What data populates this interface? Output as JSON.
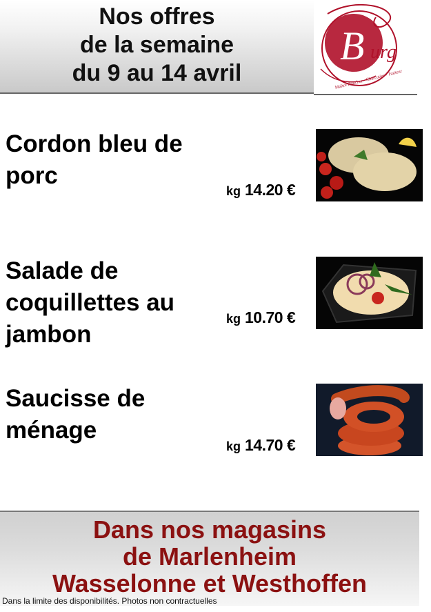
{
  "header": {
    "title_lines": [
      "Nos offres",
      "de la semaine",
      "du 9 au 14 avril"
    ]
  },
  "logo": {
    "letter": "B",
    "text": "urg",
    "tagline": "Maître Boucher - Charcutier - Traiteur",
    "color": "#b0112a"
  },
  "products": [
    {
      "name_lines": [
        "Cordon bleu de",
        "porc"
      ],
      "unit": "kg",
      "price": "14.20 €"
    },
    {
      "name_lines": [
        "Salade de",
        "coquillettes au",
        "jambon"
      ],
      "unit": "kg",
      "price": "10.70 €"
    },
    {
      "name_lines": [
        "Saucisse de",
        "ménage"
      ],
      "unit": "kg",
      "price": "14.70 €"
    }
  ],
  "footer": {
    "lines": [
      "Dans nos magasins",
      "de Marlenheim",
      "Wasselonne et Westhoffen"
    ],
    "color": "#8b1111"
  },
  "footnote": "Dans la limite des disponibilités. Photos non contractuelles"
}
